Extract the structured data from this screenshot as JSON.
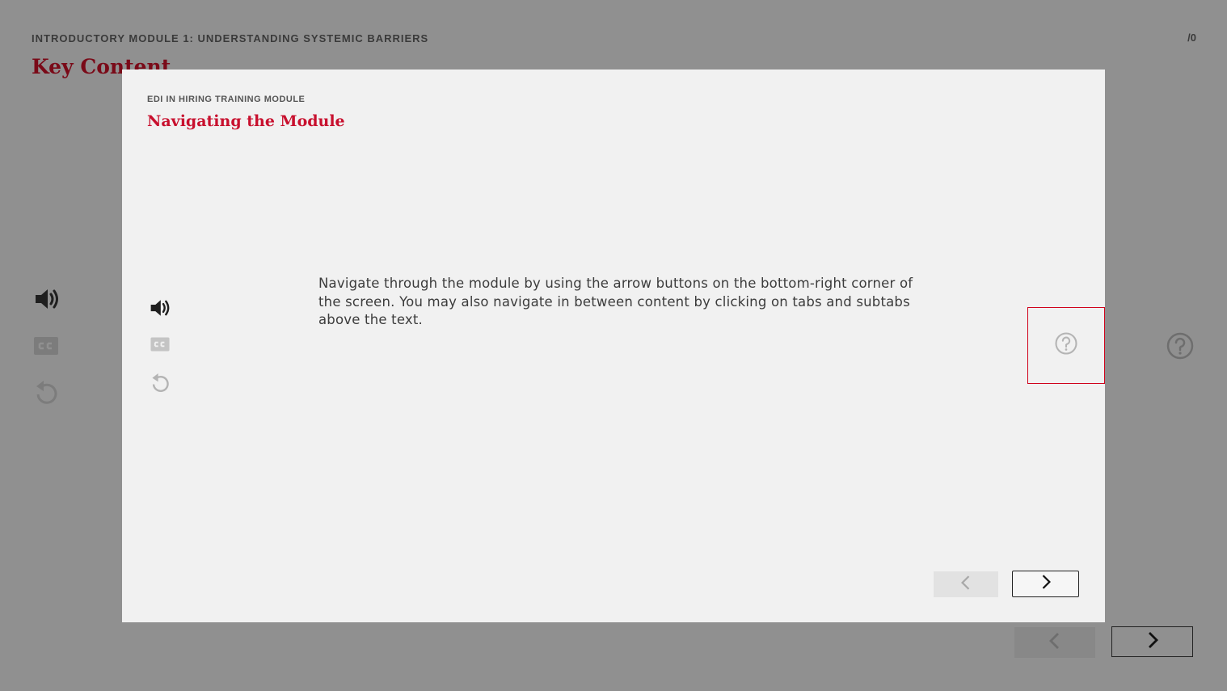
{
  "background": {
    "module_header": "INTRODUCTORY MODULE 1: UNDERSTANDING SYSTEMIC BARRIERS",
    "page_counter": "/0",
    "section_title": "Key Content"
  },
  "modal": {
    "label": "EDI IN HIRING TRAINING MODULE",
    "title": "Navigating the Module",
    "body": "Navigate through the module by using the arrow buttons on the bottom-right corner of the screen. You may also navigate in between content by clicking on tabs and subtabs above the text."
  },
  "icons": {
    "audio": "speaker-icon",
    "captions": "closed-captions-icon",
    "replay": "replay-icon",
    "help": "help-icon",
    "prev": "chevron-left-icon",
    "next": "chevron-right-icon"
  },
  "colors": {
    "overlay_bg": "#909090",
    "modal_bg": "#f1f1f1",
    "accent_red": "#c8102e",
    "highlight_border": "#d0021b"
  }
}
